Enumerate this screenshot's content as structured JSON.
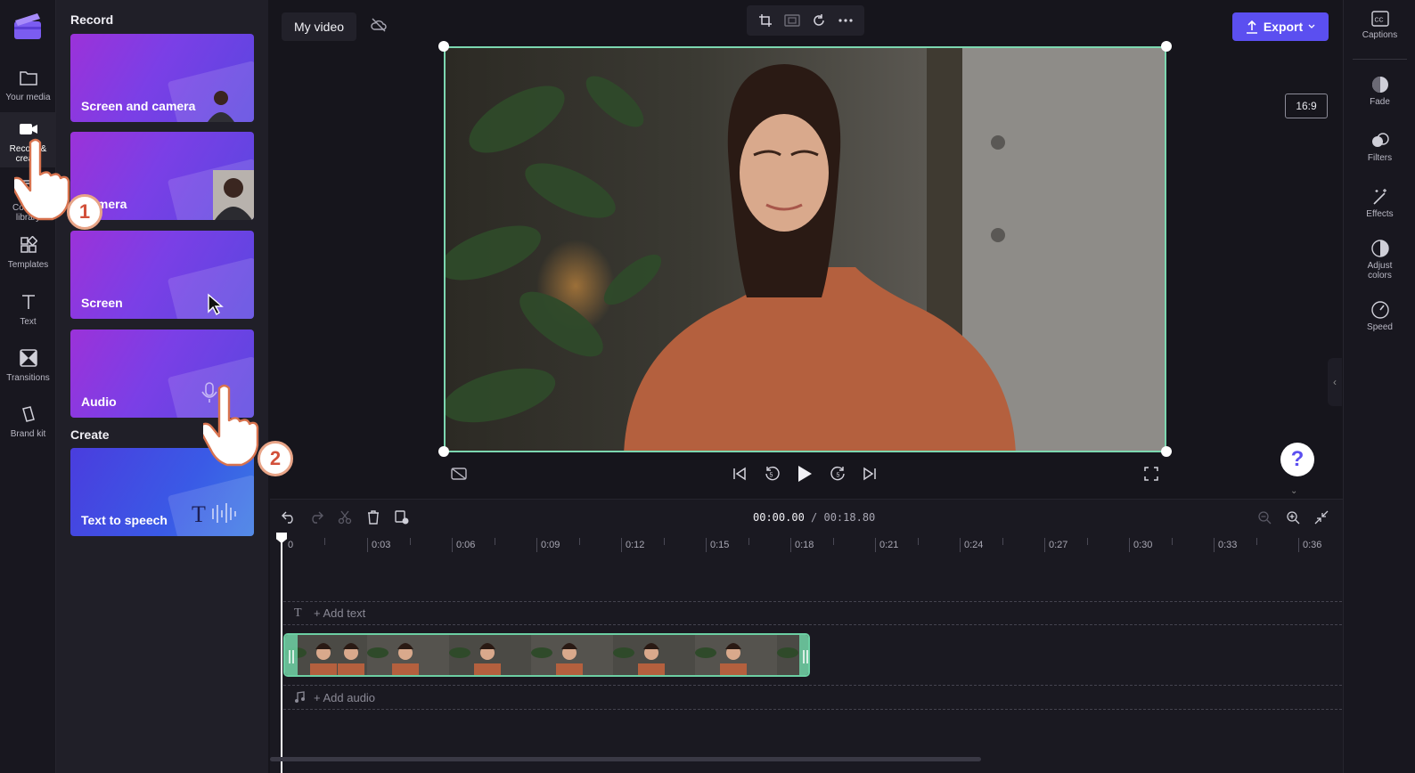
{
  "rail": {
    "items": [
      {
        "label": "Your media",
        "icon": "folder-icon"
      },
      {
        "label": "Record & create",
        "icon": "video-camera-icon"
      },
      {
        "label": "Content library",
        "icon": "library-icon"
      },
      {
        "label": "Templates",
        "icon": "templates-icon"
      },
      {
        "label": "Text",
        "icon": "text-icon"
      },
      {
        "label": "Transitions",
        "icon": "transitions-icon"
      },
      {
        "label": "Brand kit",
        "icon": "brand-kit-icon"
      }
    ]
  },
  "panel": {
    "record_heading": "Record",
    "record_cards": [
      {
        "label": "Screen and camera"
      },
      {
        "label": "Camera"
      },
      {
        "label": "Screen"
      },
      {
        "label": "Audio"
      }
    ],
    "create_heading": "Create",
    "create_cards": [
      {
        "label": "Text to speech"
      }
    ]
  },
  "header": {
    "project_title": "My video",
    "export_label": "Export",
    "aspect_ratio": "16:9"
  },
  "right_rail": {
    "items": [
      {
        "label": "Captions",
        "icon": "captions-icon"
      },
      {
        "label": "Fade",
        "icon": "fade-icon"
      },
      {
        "label": "Filters",
        "icon": "filters-icon"
      },
      {
        "label": "Effects",
        "icon": "effects-icon"
      },
      {
        "label": "Adjust colors",
        "icon": "adjust-colors-icon"
      },
      {
        "label": "Speed",
        "icon": "speed-icon"
      }
    ]
  },
  "help": {
    "label": "?"
  },
  "timeline": {
    "current_time": "00:00.00",
    "total_time": "/ 00:18.80",
    "ruler": [
      "0",
      "0:03",
      "0:06",
      "0:09",
      "0:12",
      "0:15",
      "0:18",
      "0:21",
      "0:24",
      "0:27",
      "0:30",
      "0:33",
      "0:36"
    ],
    "add_text_label": "+ Add text",
    "add_audio_label": "+ Add audio"
  },
  "annotations": {
    "step_1": "1",
    "step_2": "2"
  },
  "colors": {
    "accent": "#5b4ff0",
    "selection": "#7cd7b0",
    "panel_bg": "#201f28"
  }
}
